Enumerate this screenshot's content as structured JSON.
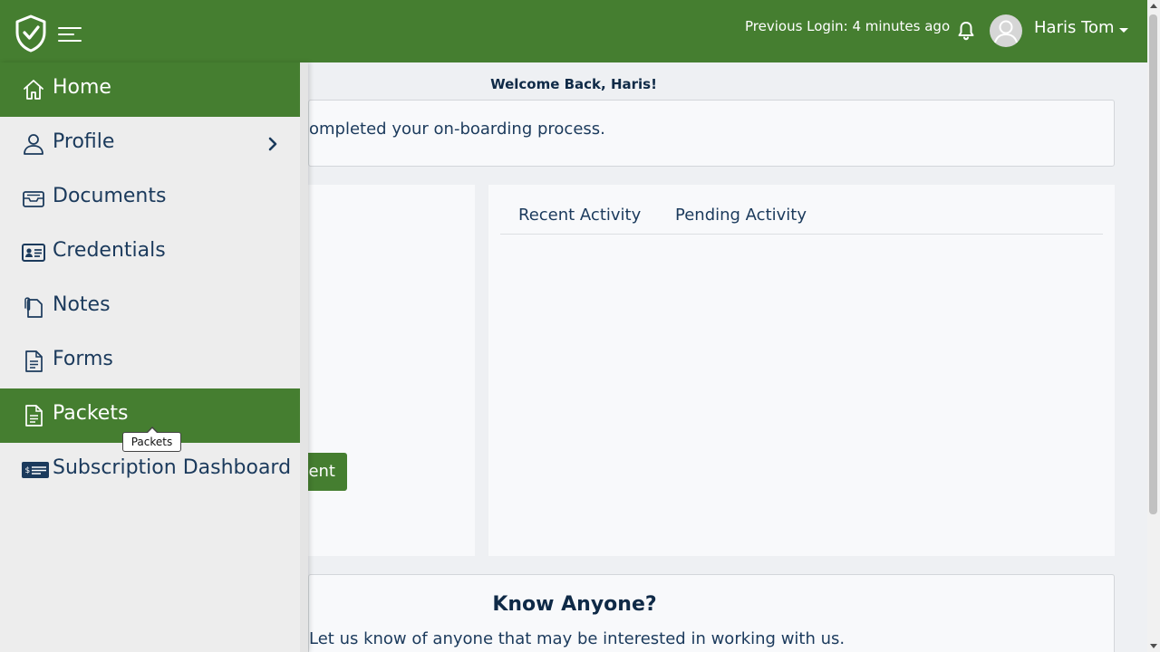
{
  "header": {
    "previous_login": "Previous Login: 4 minutes ago",
    "user_name": "Haris Tom",
    "brand_color": "#457e30"
  },
  "main": {
    "welcome": "Welcome Back, Haris!",
    "onboarding_text": "ompleted your on-boarding process.",
    "document_button": "ent",
    "activity_tabs": [
      "Recent Activity",
      "Pending Activity"
    ],
    "know_title": "Know Anyone?",
    "know_subtitle": "Let us know of anyone that may be interested in working with us."
  },
  "sidebar": {
    "items": [
      {
        "label": "Home",
        "icon": "home-icon",
        "active": true
      },
      {
        "label": "Profile",
        "icon": "user-icon",
        "active": false,
        "has_submenu": true
      },
      {
        "label": "Documents",
        "icon": "inbox-icon",
        "active": false
      },
      {
        "label": "Credentials",
        "icon": "id-card-icon",
        "active": false
      },
      {
        "label": "Notes",
        "icon": "paperclip-icon",
        "active": false
      },
      {
        "label": "Forms",
        "icon": "file-icon",
        "active": false
      },
      {
        "label": "Packets",
        "icon": "file-icon",
        "active": true
      },
      {
        "label": "Subscription Dashboard",
        "icon": "money-bill-icon",
        "active": false
      }
    ]
  },
  "tooltip": {
    "text": "Packets"
  }
}
